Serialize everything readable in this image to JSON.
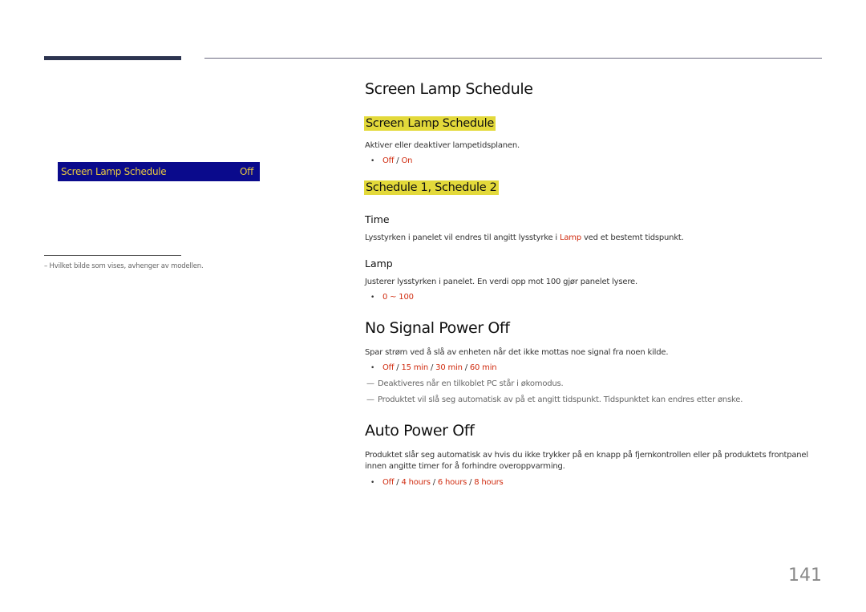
{
  "left_panel": {
    "menu_item_label": "Screen Lamp Schedule",
    "menu_item_value": "Off",
    "footnote": "–  Hvilket bilde som vises, avhenger av modellen."
  },
  "sections": {
    "lamp": {
      "title": "Screen Lamp Schedule",
      "sub1_title": "Screen Lamp Schedule",
      "sub1_desc": "Aktiver eller deaktiver lampetidsplanen.",
      "sub1_options": [
        "Off",
        "On"
      ],
      "sub2_title": "Schedule 1, Schedule 2",
      "time_title": "Time",
      "time_desc_before": "Lysstyrken i panelet vil endres til angitt lysstyrke i ",
      "time_desc_link": "Lamp",
      "time_desc_after": " ved et bestemt tidspunkt.",
      "lamp_title": "Lamp",
      "lamp_desc": "Justerer lysstyrken i panelet. En verdi opp mot 100 gjør panelet lysere.",
      "lamp_range": "0 ~ 100"
    },
    "no_signal": {
      "title": "No Signal Power Off",
      "desc": "Spar strøm ved å slå av enheten når det ikke mottas noe signal fra noen kilde.",
      "options": [
        "Off",
        "15 min",
        "30 min",
        "60 min"
      ],
      "notes": [
        "Deaktiveres når en tilkoblet PC står i økomodus.",
        "Produktet vil slå seg automatisk av på et angitt tidspunkt. Tidspunktet kan endres etter ønske."
      ]
    },
    "auto_power": {
      "title": "Auto Power Off",
      "desc": "Produktet slår seg automatisk av hvis du ikke trykker på en knapp på fjernkontrollen eller på produktets frontpanel innen angitte timer for å forhindre overoppvarming.",
      "options": [
        "Off",
        "4 hours",
        "6 hours",
        "8 hours"
      ]
    }
  },
  "separator": " / ",
  "bullet": "•",
  "note_dash": "—",
  "page_number": "141"
}
